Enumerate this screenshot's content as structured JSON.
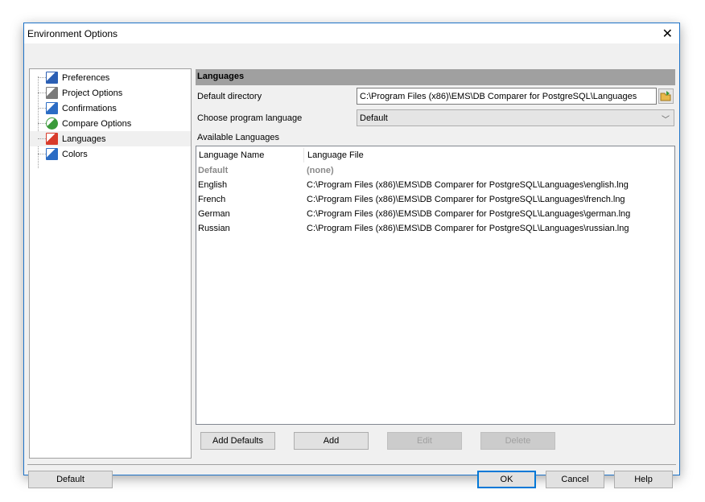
{
  "window": {
    "title": "Environment Options"
  },
  "tree": {
    "items": [
      {
        "label": "Preferences",
        "icon": "preferences-icon",
        "color": "#2b5fb4"
      },
      {
        "label": "Project Options",
        "icon": "project-options-icon",
        "color": "#7a7a7a"
      },
      {
        "label": "Confirmations",
        "icon": "confirmations-icon",
        "color": "#2b6cc4"
      },
      {
        "label": "Compare Options",
        "icon": "compare-options-icon",
        "color": "#3a9a3a"
      },
      {
        "label": "Languages",
        "icon": "languages-flags-icon",
        "color": "#d83b2b",
        "selected": true
      },
      {
        "label": "Colors",
        "icon": "colors-icon",
        "color": "#2b6cc4"
      }
    ]
  },
  "panel": {
    "header": "Languages",
    "default_directory_label": "Default directory",
    "default_directory_value": "C:\\Program Files (x86)\\EMS\\DB Comparer for PostgreSQL\\Languages",
    "choose_language_label": "Choose program language",
    "choose_language_value": "Default",
    "available_label": "Available Languages",
    "columns": [
      "Language Name",
      "Language File"
    ],
    "rows": [
      {
        "name": "Default",
        "file": "(none)",
        "disabled": true
      },
      {
        "name": "English",
        "file": "C:\\Program Files (x86)\\EMS\\DB Comparer for PostgreSQL\\Languages\\english.lng"
      },
      {
        "name": "French",
        "file": "C:\\Program Files (x86)\\EMS\\DB Comparer for PostgreSQL\\Languages\\french.lng"
      },
      {
        "name": "German",
        "file": "C:\\Program Files (x86)\\EMS\\DB Comparer for PostgreSQL\\Languages\\german.lng"
      },
      {
        "name": "Russian",
        "file": "C:\\Program Files (x86)\\EMS\\DB Comparer for PostgreSQL\\Languages\\russian.lng"
      }
    ],
    "buttons": {
      "add_defaults": "Add Defaults",
      "add": "Add",
      "edit": "Edit",
      "delete": "Delete"
    }
  },
  "footer": {
    "default": "Default",
    "ok": "OK",
    "cancel": "Cancel",
    "help": "Help"
  }
}
